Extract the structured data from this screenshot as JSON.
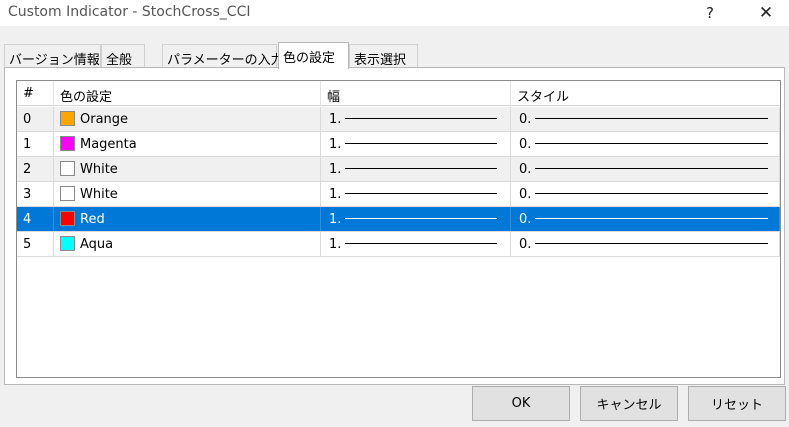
{
  "window": {
    "title": "Custom Indicator - StochCross_CCI",
    "help": "?",
    "close": "✕"
  },
  "tabs": [
    {
      "label": "バージョン情報",
      "active": false
    },
    {
      "label": "全般",
      "active": false
    },
    {
      "label": "パラメーターの入力",
      "active": false
    },
    {
      "label": "色の設定",
      "active": true
    },
    {
      "label": "表示選択",
      "active": false
    }
  ],
  "grid": {
    "headers": {
      "index": "#",
      "color": "色の設定",
      "width": "幅",
      "style": "スタイル"
    },
    "rows": [
      {
        "index": "0",
        "color_name": "Orange",
        "color_hex": "#ffa500",
        "width": "1.",
        "style": "0."
      },
      {
        "index": "1",
        "color_name": "Magenta",
        "color_hex": "#ff00ff",
        "width": "1.",
        "style": "0."
      },
      {
        "index": "2",
        "color_name": "White",
        "color_hex": "#ffffff",
        "width": "1.",
        "style": "0."
      },
      {
        "index": "3",
        "color_name": "White",
        "color_hex": "#ffffff",
        "width": "1.",
        "style": "0."
      },
      {
        "index": "4",
        "color_name": "Red",
        "color_hex": "#ff0000",
        "width": "1.",
        "style": "0.",
        "selected": true
      },
      {
        "index": "5",
        "color_name": "Aqua",
        "color_hex": "#00ffff",
        "width": "1.",
        "style": "0."
      }
    ]
  },
  "buttons": {
    "ok": "OK",
    "cancel": "キャンセル",
    "reset": "リセット"
  },
  "colors": {
    "selection": "#0078d7",
    "alt_row": "#f0f0f0"
  }
}
